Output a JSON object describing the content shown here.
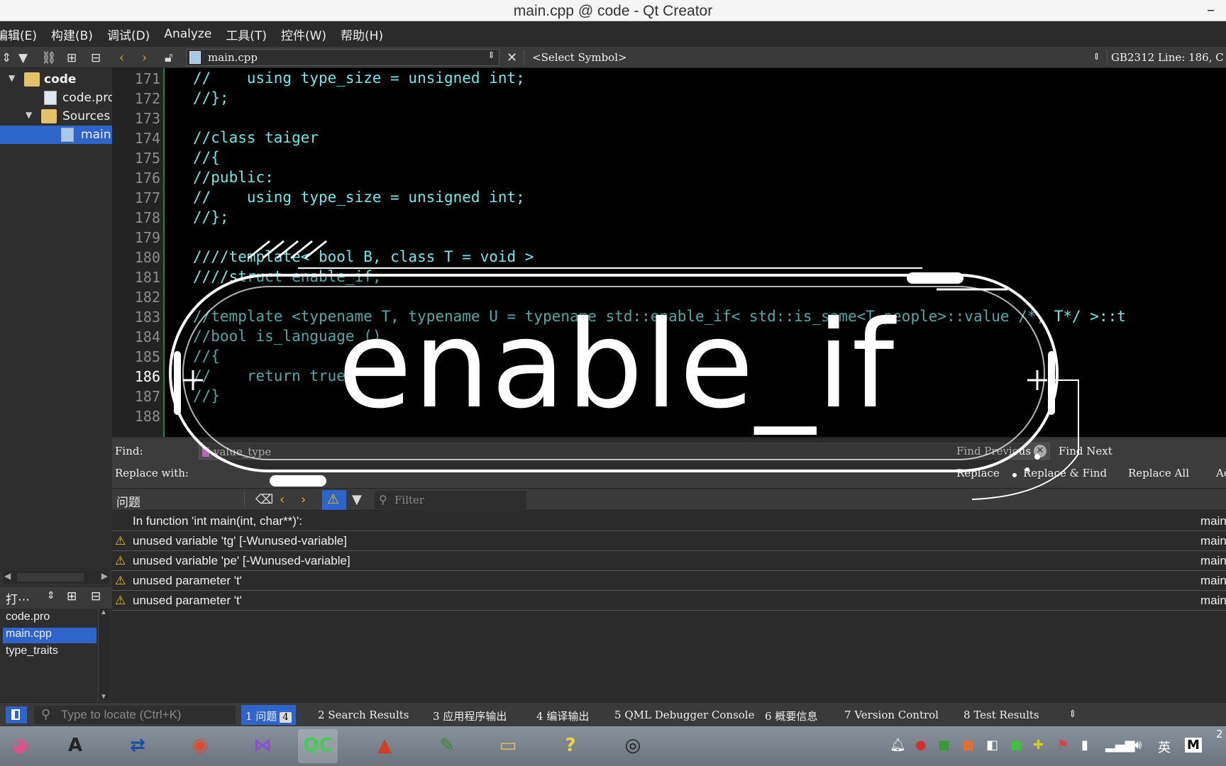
{
  "window": {
    "title": "main.cpp @ code - Qt Creator",
    "minimize": "–"
  },
  "menu": [
    "编辑(E)",
    "构建(B)",
    "调试(D)",
    "Analyze",
    "工具(T)",
    "控件(W)",
    "帮助(H)"
  ],
  "editor_toolbar": {
    "file_combo": "main.cpp",
    "symbol_combo": "<Select Symbol>",
    "encoding_position": "GB2312 Line: 186, C"
  },
  "project_tree": [
    {
      "label": "code",
      "type": "project",
      "depth": 0,
      "expanded": true,
      "bold": true
    },
    {
      "label": "code.pro",
      "type": "file",
      "depth": 1
    },
    {
      "label": "Sources",
      "type": "folder",
      "depth": 1,
      "expanded": true
    },
    {
      "label": "main.cpp",
      "type": "file",
      "depth": 2,
      "selected": true
    }
  ],
  "open_files": {
    "header": "打⋯",
    "items": [
      {
        "label": "code.pro",
        "selected": false
      },
      {
        "label": "main.cpp",
        "selected": true
      },
      {
        "label": "type_traits",
        "selected": false
      }
    ]
  },
  "editor": {
    "current_line": "186",
    "lines": [
      {
        "n": "171",
        "text": "//    using type_size = unsigned int;"
      },
      {
        "n": "172",
        "text": "//};"
      },
      {
        "n": "173",
        "text": ""
      },
      {
        "n": "174",
        "text": "//class taiger"
      },
      {
        "n": "175",
        "text": "//{"
      },
      {
        "n": "176",
        "text": "//public:"
      },
      {
        "n": "177",
        "text": "//    using type_size = unsigned int;"
      },
      {
        "n": "178",
        "text": "//};"
      },
      {
        "n": "179",
        "text": ""
      },
      {
        "n": "180",
        "text": "////template< bool B, class T = void >"
      },
      {
        "n": "181",
        "text": "////struct enable_if;"
      },
      {
        "n": "182",
        "text": ""
      },
      {
        "n": "183",
        "text": "//template <typename T, typename U = typename std::enable_if< std::is_same<T,people>::value /*, T*/ >::t"
      },
      {
        "n": "184",
        "text": "//bool is_language ()"
      },
      {
        "n": "185",
        "text": "//{"
      },
      {
        "n": "186",
        "text": "//    return true;"
      },
      {
        "n": "187",
        "text": "//}"
      },
      {
        "n": "188",
        "text": ""
      }
    ]
  },
  "find": {
    "find_label": "Find:",
    "find_value": "value_type",
    "replace_label": "Replace with:",
    "find_previous": "Find Previous",
    "find_next": "Find Next",
    "replace": "Replace",
    "replace_find": "Replace & Find",
    "replace_all": "Replace All",
    "advanced": "Ad"
  },
  "issues": {
    "title": "问题",
    "filter_placeholder": "Filter",
    "rows": [
      {
        "text": "In function 'int main(int, char**)':",
        "warning": false,
        "file": "main.cpp"
      },
      {
        "text": "unused variable 'tg' [-Wunused-variable]",
        "warning": true,
        "file": "main.cpp"
      },
      {
        "text": "unused variable 'pe' [-Wunused-variable]",
        "warning": true,
        "file": "main.cpp"
      },
      {
        "text": "unused parameter 't'",
        "warning": true,
        "file": "main.cpp"
      },
      {
        "text": "unused parameter 't'",
        "warning": true,
        "file": "main.cpp"
      }
    ]
  },
  "statusbar": {
    "locate_placeholder": "Type to locate (Ctrl+K)",
    "tabs": [
      {
        "num": "1",
        "label": "问题",
        "badge": "4",
        "active": true
      },
      {
        "num": "2",
        "label": "Search Results"
      },
      {
        "num": "3",
        "label": "应用程序输出"
      },
      {
        "num": "4",
        "label": "编译输出"
      },
      {
        "num": "5",
        "label": "QML Debugger Console"
      },
      {
        "num": "6",
        "label": "概要信息"
      },
      {
        "num": "7",
        "label": "Version Control"
      },
      {
        "num": "8",
        "label": "Test Results"
      }
    ]
  },
  "taskbar": {
    "apps": [
      {
        "icon": "start-orb-icon",
        "glyph": "◕",
        "color": "#e0508a"
      },
      {
        "icon": "font-app-icon",
        "glyph": "A",
        "color": "#222222"
      },
      {
        "icon": "network-app-icon",
        "glyph": "⇄",
        "color": "#1a4fa0"
      },
      {
        "icon": "chrome-icon",
        "glyph": "◉",
        "color": "#e04a2a"
      },
      {
        "icon": "visual-studio-icon",
        "glyph": "⋈",
        "color": "#8a4fd0"
      },
      {
        "icon": "qt-creator-icon",
        "glyph": "QC",
        "color": "#41cd52"
      },
      {
        "icon": "matlab-icon",
        "glyph": "▲",
        "color": "#d04020"
      },
      {
        "icon": "notepad-icon",
        "glyph": "✎",
        "color": "#3a8a2a"
      },
      {
        "icon": "file-explorer-icon",
        "glyph": "▭",
        "color": "#e8c060"
      },
      {
        "icon": "help-icon",
        "glyph": "?",
        "color": "#f0d040"
      },
      {
        "icon": "obs-icon",
        "glyph": "◎",
        "color": "#222222"
      }
    ],
    "ime": "英",
    "clock_fragment": "2"
  },
  "overlay": {
    "word": "enable_if"
  }
}
